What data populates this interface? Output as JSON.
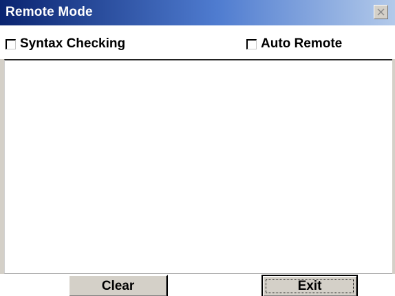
{
  "window": {
    "title": "Remote Mode"
  },
  "options": {
    "syntax_checking": {
      "label": "Syntax Checking",
      "checked": false
    },
    "auto_remote": {
      "label": "Auto Remote",
      "checked": false
    }
  },
  "output": {
    "text": ""
  },
  "buttons": {
    "clear_label": "Clear",
    "exit_label": "Exit"
  },
  "colors": {
    "titlebar_start": "#0a2470",
    "titlebar_end": "#b3caea",
    "button_face": "#d4d0c8"
  },
  "icons": {
    "close": "close-icon",
    "checkbox": "checkbox-icon"
  }
}
